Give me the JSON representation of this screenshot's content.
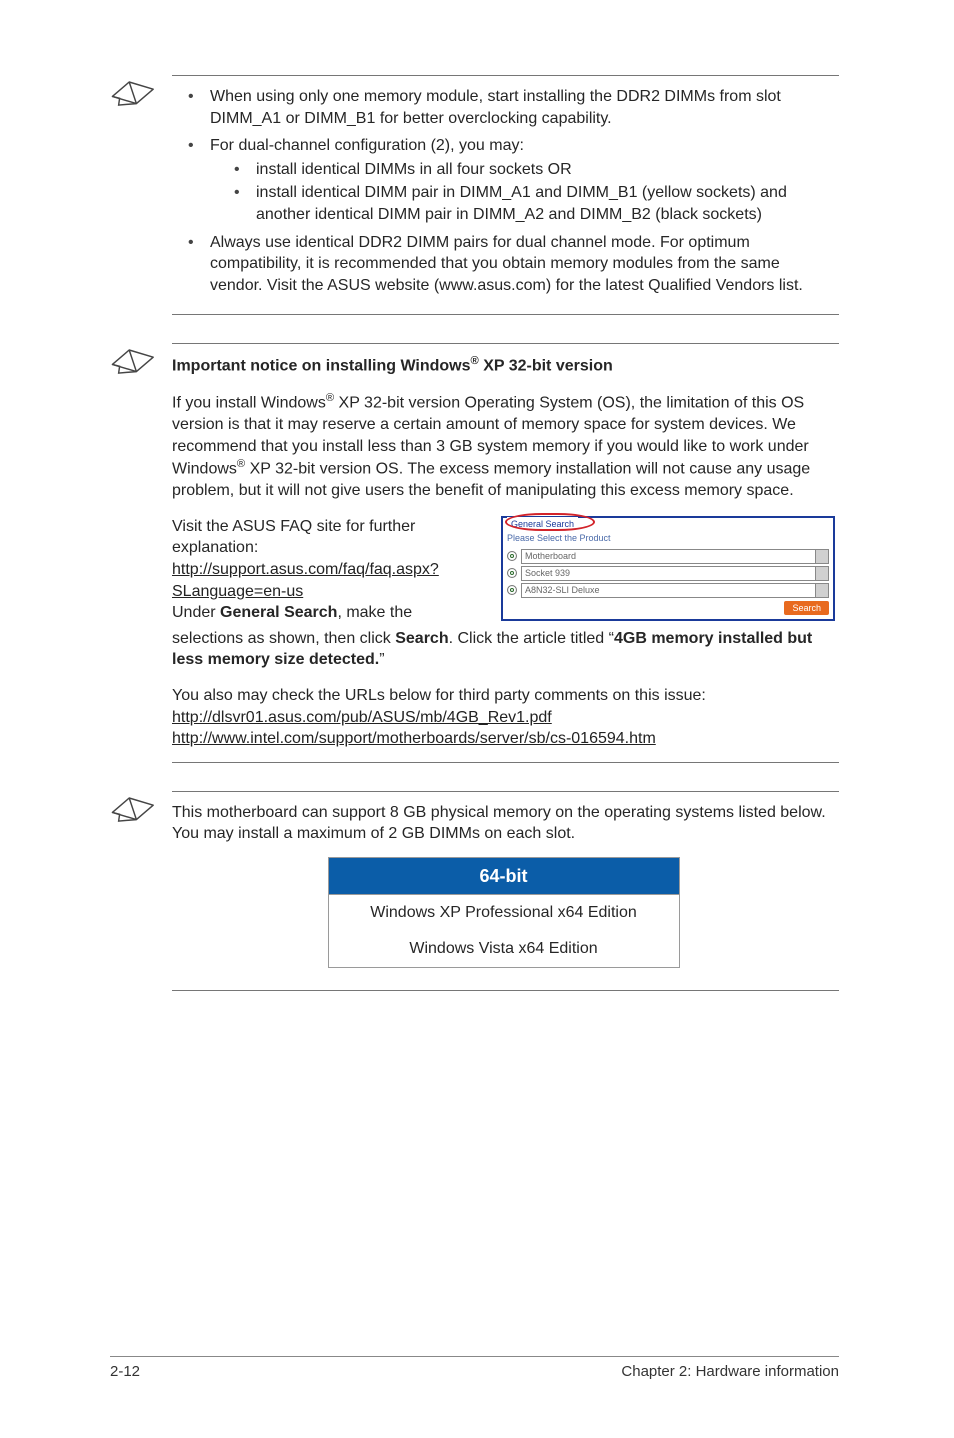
{
  "note1": {
    "bullets": [
      "When using only one memory module, start installing the DDR2 DIMMs from slot DIMM_A1 or DIMM_B1 for better overclocking capability.",
      "For dual-channel configuration (2), you may:"
    ],
    "sub_bullets": [
      "install identical DIMMs in all four sockets OR",
      "install identical DIMM pair in DIMM_A1 and DIMM_B1 (yellow sockets) and another identical DIMM pair in DIMM_A2 and DIMM_B2 (black sockets)"
    ],
    "bullet3": "Always use identical DDR2 DIMM pairs for dual channel mode. For optimum compatibility, it is recommended that you obtain memory modules from the same vendor.  Visit the ASUS website (www.asus.com) for the latest Qualified Vendors list."
  },
  "note2": {
    "heading_pre": "Important notice on installing Windows",
    "heading_sup": "®",
    "heading_post": " XP 32-bit version",
    "para1_pre": "If you install Windows",
    "para1_sup": "®",
    "para1_post_a": " XP 32-bit version Operating System (OS), the limitation of this OS version is that it may reserve a certain amount of memory space for system devices. We recommend that you install less than 3 GB system memory if you would like to work under Windows",
    "para1_sup2": "®",
    "para1_post_b": " XP 32-bit version OS. The excess memory installation will not cause any usage problem, but it will not give users the benefit of manipulating this excess memory space.",
    "faq_intro": "Visit the ASUS FAQ site for further explanation:",
    "faq_link": "http://support.asus.com/faq/faq.aspx?SLanguage=en-us",
    "under_pre": "Under ",
    "under_bold": "General Search",
    "under_post": ", make the",
    "sel_pre": "selections as shown, then click ",
    "sel_bold1": "Search",
    "sel_mid": ". Click the article titled “",
    "sel_bold2": "4GB memory installed but less memory size detected.",
    "sel_post": "”",
    "third_party": "You also may check the URLs below for third party comments on this issue:",
    "url1": "http://dlsvr01.asus.com/pub/ASUS/mb/4GB_Rev1.pdf",
    "url2": "http://www.intel.com/support/motherboards/server/sb/cs-016594.htm"
  },
  "faq_image": {
    "tab_label": "General Search",
    "please_select": "Please Select the Product",
    "dd1": "Motherboard",
    "dd2": "Socket 939",
    "dd3": "A8N32-SLI Deluxe",
    "search_btn": "Search"
  },
  "note3": {
    "para": "This motherboard can support 8 GB physical memory on the operating systems listed below. You may install a maximum of 2 GB DIMMs on each slot.",
    "table": {
      "header": "64-bit",
      "row1": "Windows XP Professional x64 Edition",
      "row2": "Windows Vista x64 Edition"
    }
  },
  "footer": {
    "left": "2-12",
    "right": "Chapter 2: Hardware information"
  }
}
